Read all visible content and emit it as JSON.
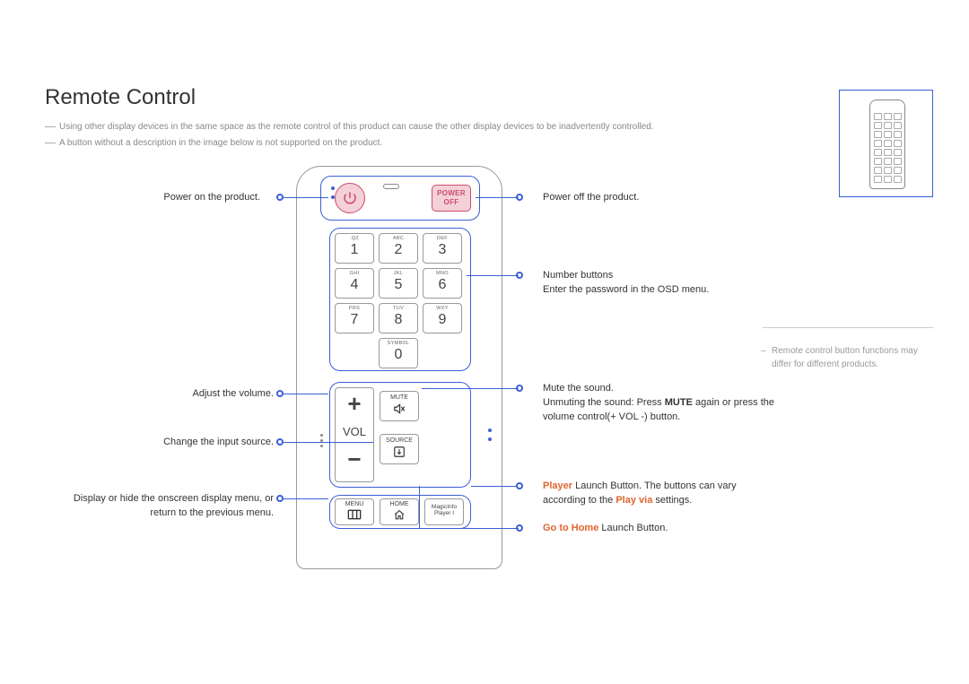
{
  "title": "Remote Control",
  "notes": {
    "n1": "Using other display devices in the same space as the remote control of this product can cause the other display devices to be inadvertently controlled.",
    "n2": "A button without a description in the image below is not supported on the product."
  },
  "side_note": "Remote control button functions may differ for different products.",
  "remote": {
    "power_off_label": "POWER OFF",
    "keypad": [
      {
        "d": "1",
        "t": ".QZ"
      },
      {
        "d": "2",
        "t": "ABC"
      },
      {
        "d": "3",
        "t": "DEF"
      },
      {
        "d": "4",
        "t": "GHI"
      },
      {
        "d": "5",
        "t": "JKL"
      },
      {
        "d": "6",
        "t": "MNO"
      },
      {
        "d": "7",
        "t": "PRS"
      },
      {
        "d": "8",
        "t": "TUV"
      },
      {
        "d": "9",
        "t": "WXY"
      },
      {
        "d": "0",
        "t": "SYMBOL"
      }
    ],
    "vol_label": "VOL",
    "mute_label": "MUTE",
    "source_label": "SOURCE",
    "menu_label": "MENU",
    "home_label": "HOME",
    "magic_label_1": "MagicInfo",
    "magic_label_2": "Player I"
  },
  "callouts": {
    "power_on": "Power on the product.",
    "power_off": "Power off the product.",
    "numbers_1": "Number buttons",
    "numbers_2": "Enter the password in the OSD menu.",
    "volume": "Adjust the volume.",
    "source": "Change the input source.",
    "menu_1": "Display or hide the onscreen display menu, or",
    "menu_2": "return to the previous menu.",
    "mute_1": "Mute the sound.",
    "mute_prefix": "Unmuting the sound: Press ",
    "mute_bold": "MUTE",
    "mute_suffix": " again or press the volume control(+ VOL -) button.",
    "player_hl": "Player",
    "player_txt": " Launch Button. The buttons can vary according to the ",
    "player_hl2": "Play via",
    "player_txt2": " settings.",
    "home_hl": "Go to Home",
    "home_txt": " Launch Button."
  }
}
